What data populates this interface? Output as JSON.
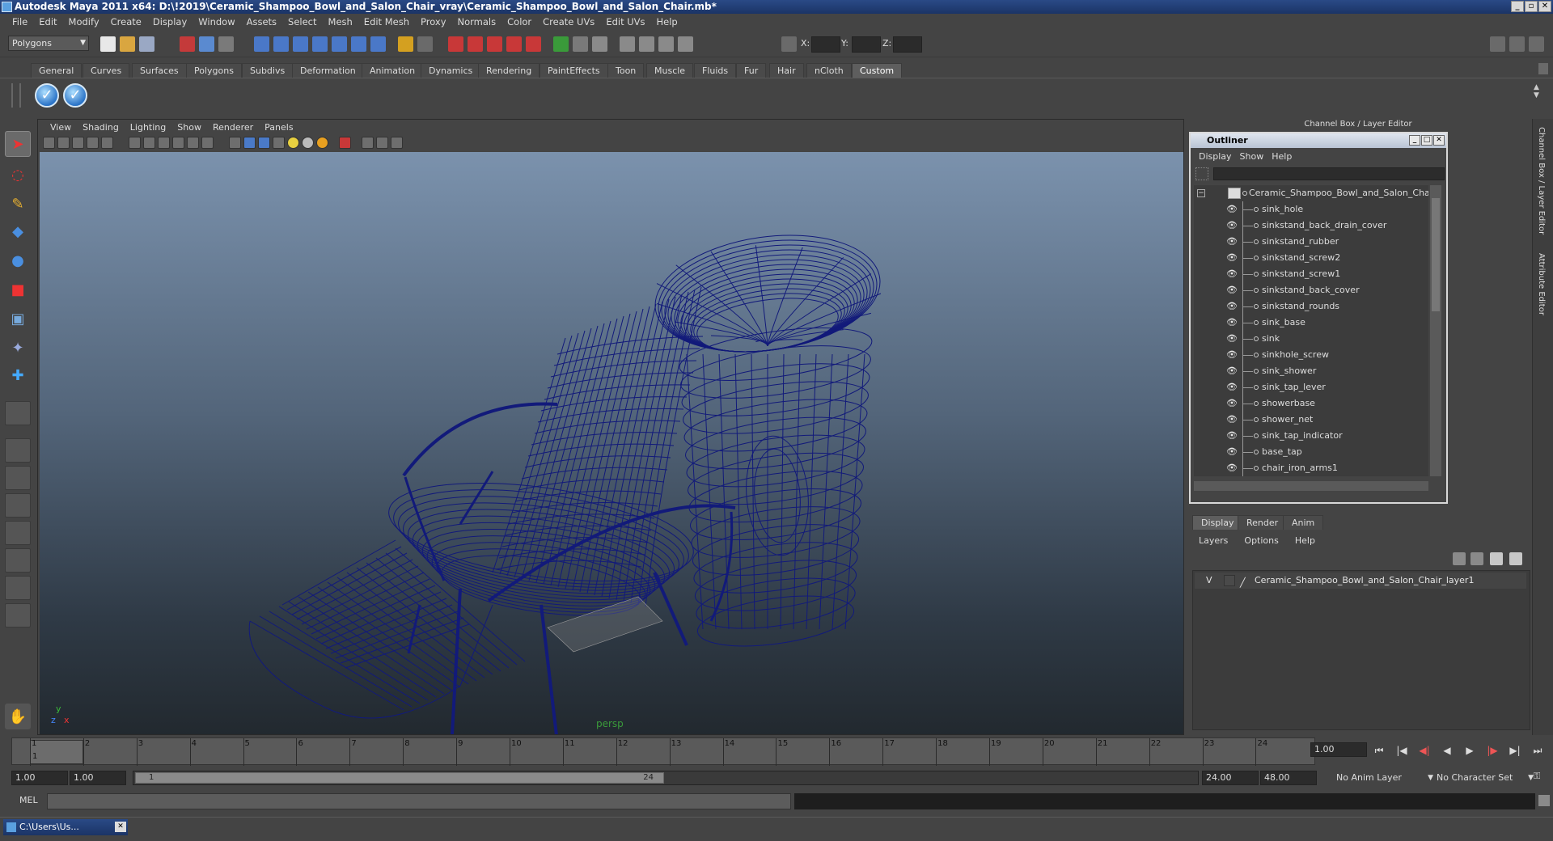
{
  "window": {
    "title": "Autodesk Maya 2011 x64: D:\\!2019\\Ceramic_Shampoo_Bowl_and_Salon_Chair_vray\\Ceramic_Shampoo_Bowl_and_Salon_Chair.mb*",
    "buttons": [
      "_",
      "▫",
      "✕"
    ]
  },
  "menubar": [
    "File",
    "Edit",
    "Modify",
    "Create",
    "Display",
    "Window",
    "Assets",
    "Select",
    "Mesh",
    "Edit Mesh",
    "Proxy",
    "Normals",
    "Color",
    "Create UVs",
    "Edit UVs",
    "Help"
  ],
  "statusline": {
    "mode": "Polygons",
    "coord_labels": {
      "x": "X:",
      "y": "Y:",
      "z": "Z:"
    }
  },
  "shelf": {
    "tabs": [
      "General",
      "Curves",
      "Surfaces",
      "Polygons",
      "Subdivs",
      "Deformation",
      "Animation",
      "Dynamics",
      "Rendering",
      "PaintEffects",
      "Toon",
      "Muscle",
      "Fluids",
      "Fur",
      "Hair",
      "nCloth",
      "Custom"
    ],
    "active_tab": "Custom",
    "icons": [
      "check-icon",
      "check-icon"
    ]
  },
  "viewport": {
    "menu": [
      "View",
      "Shading",
      "Lighting",
      "Show",
      "Renderer",
      "Panels"
    ],
    "camera_label": "persp",
    "axis": {
      "y": "y",
      "x": "x",
      "z": "z"
    },
    "wire_color": "#121a7a"
  },
  "right_panel": {
    "title": "Channel Box / Layer Editor",
    "side_tabs": [
      "Channel Box / Layer Editor",
      "Attribute Editor"
    ]
  },
  "outliner": {
    "title": "Outliner",
    "menu": [
      "Display",
      "Show",
      "Help"
    ],
    "root": "Ceramic_Shampoo_Bowl_and_Salon_Chair",
    "items": [
      "sink_hole",
      "sinkstand_back_drain_cover",
      "sinkstand_rubber",
      "sinkstand_screw2",
      "sinkstand_screw1",
      "sinkstand_back_cover",
      "sinkstand_rounds",
      "sink_base",
      "sink",
      "sinkhole_screw",
      "sink_shower",
      "sink_tap_lever",
      "showerbase",
      "shower_net",
      "sink_tap_indicator",
      "base_tap",
      "chair_iron_arms1"
    ]
  },
  "layer_editor": {
    "tabs": [
      "Display",
      "Render",
      "Anim"
    ],
    "active_tab": "Display",
    "menu": [
      "Layers",
      "Options",
      "Help"
    ],
    "layers": [
      {
        "visible": "V",
        "name": "Ceramic_Shampoo_Bowl_and_Salon_Chair_layer1"
      }
    ]
  },
  "timeline": {
    "ticks": [
      "1",
      "2",
      "3",
      "4",
      "5",
      "6",
      "7",
      "8",
      "9",
      "10",
      "11",
      "12",
      "13",
      "14",
      "15",
      "16",
      "17",
      "18",
      "19",
      "20",
      "21",
      "22",
      "23",
      "24"
    ],
    "current_frame": "1.00",
    "current_marker": "1"
  },
  "range": {
    "start": "1.00",
    "playback_start": "1.00",
    "slider_start": "1",
    "slider_end": "24",
    "playback_end": "24.00",
    "end": "48.00",
    "anim_layer": "No Anim Layer",
    "character_set": "No Character Set"
  },
  "command_line": {
    "label": "MEL"
  },
  "taskbar": {
    "script_window": "C:\\Users\\Us..."
  }
}
